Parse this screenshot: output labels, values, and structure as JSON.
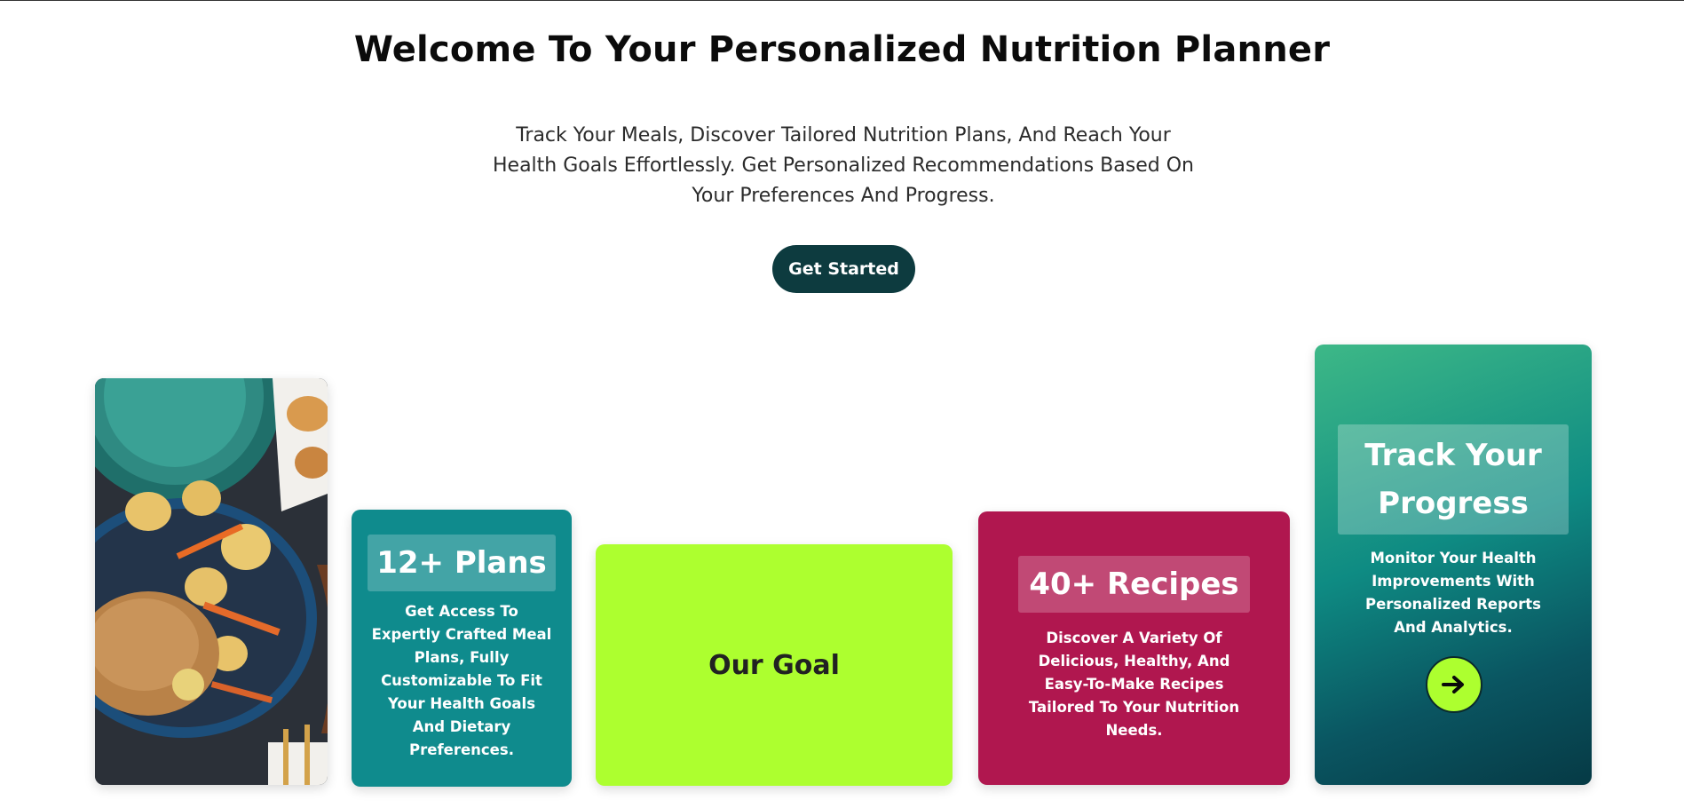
{
  "hero": {
    "title": "Welcome To Your Personalized Nutrition Planner",
    "subtitle": "Track Your Meals, Discover Tailored Nutrition Plans, And Reach Your Health Goals Effortlessly. Get Personalized Recommendations Based On Your Preferences And Progress.",
    "cta_label": "Get Started"
  },
  "cards": {
    "plans": {
      "badge": "12+ Plans",
      "description": "Get Access To Expertly Crafted Meal Plans, Fully Customizable To Fit Your Health Goals And Dietary Preferences."
    },
    "goal": {
      "title": "Our Goal"
    },
    "recipes": {
      "badge": "40+ Recipes",
      "description": "Discover A Variety Of Delicious, Healthy, And Easy-To-Make Recipes Tailored To Your Nutrition Needs."
    },
    "progress": {
      "badge": "Track Your Progress",
      "description": "Monitor Your Health Improvements With Personalized Reports And Analytics.",
      "action_icon": "arrow-right-icon"
    }
  },
  "colors": {
    "cta_bg": "#0d3b3f",
    "plans_bg": "#0f8b8d",
    "goal_bg": "#adff2f",
    "recipes_bg": "#b0174f",
    "progress_gradient_start": "#3db887",
    "progress_gradient_end": "#063a45"
  }
}
